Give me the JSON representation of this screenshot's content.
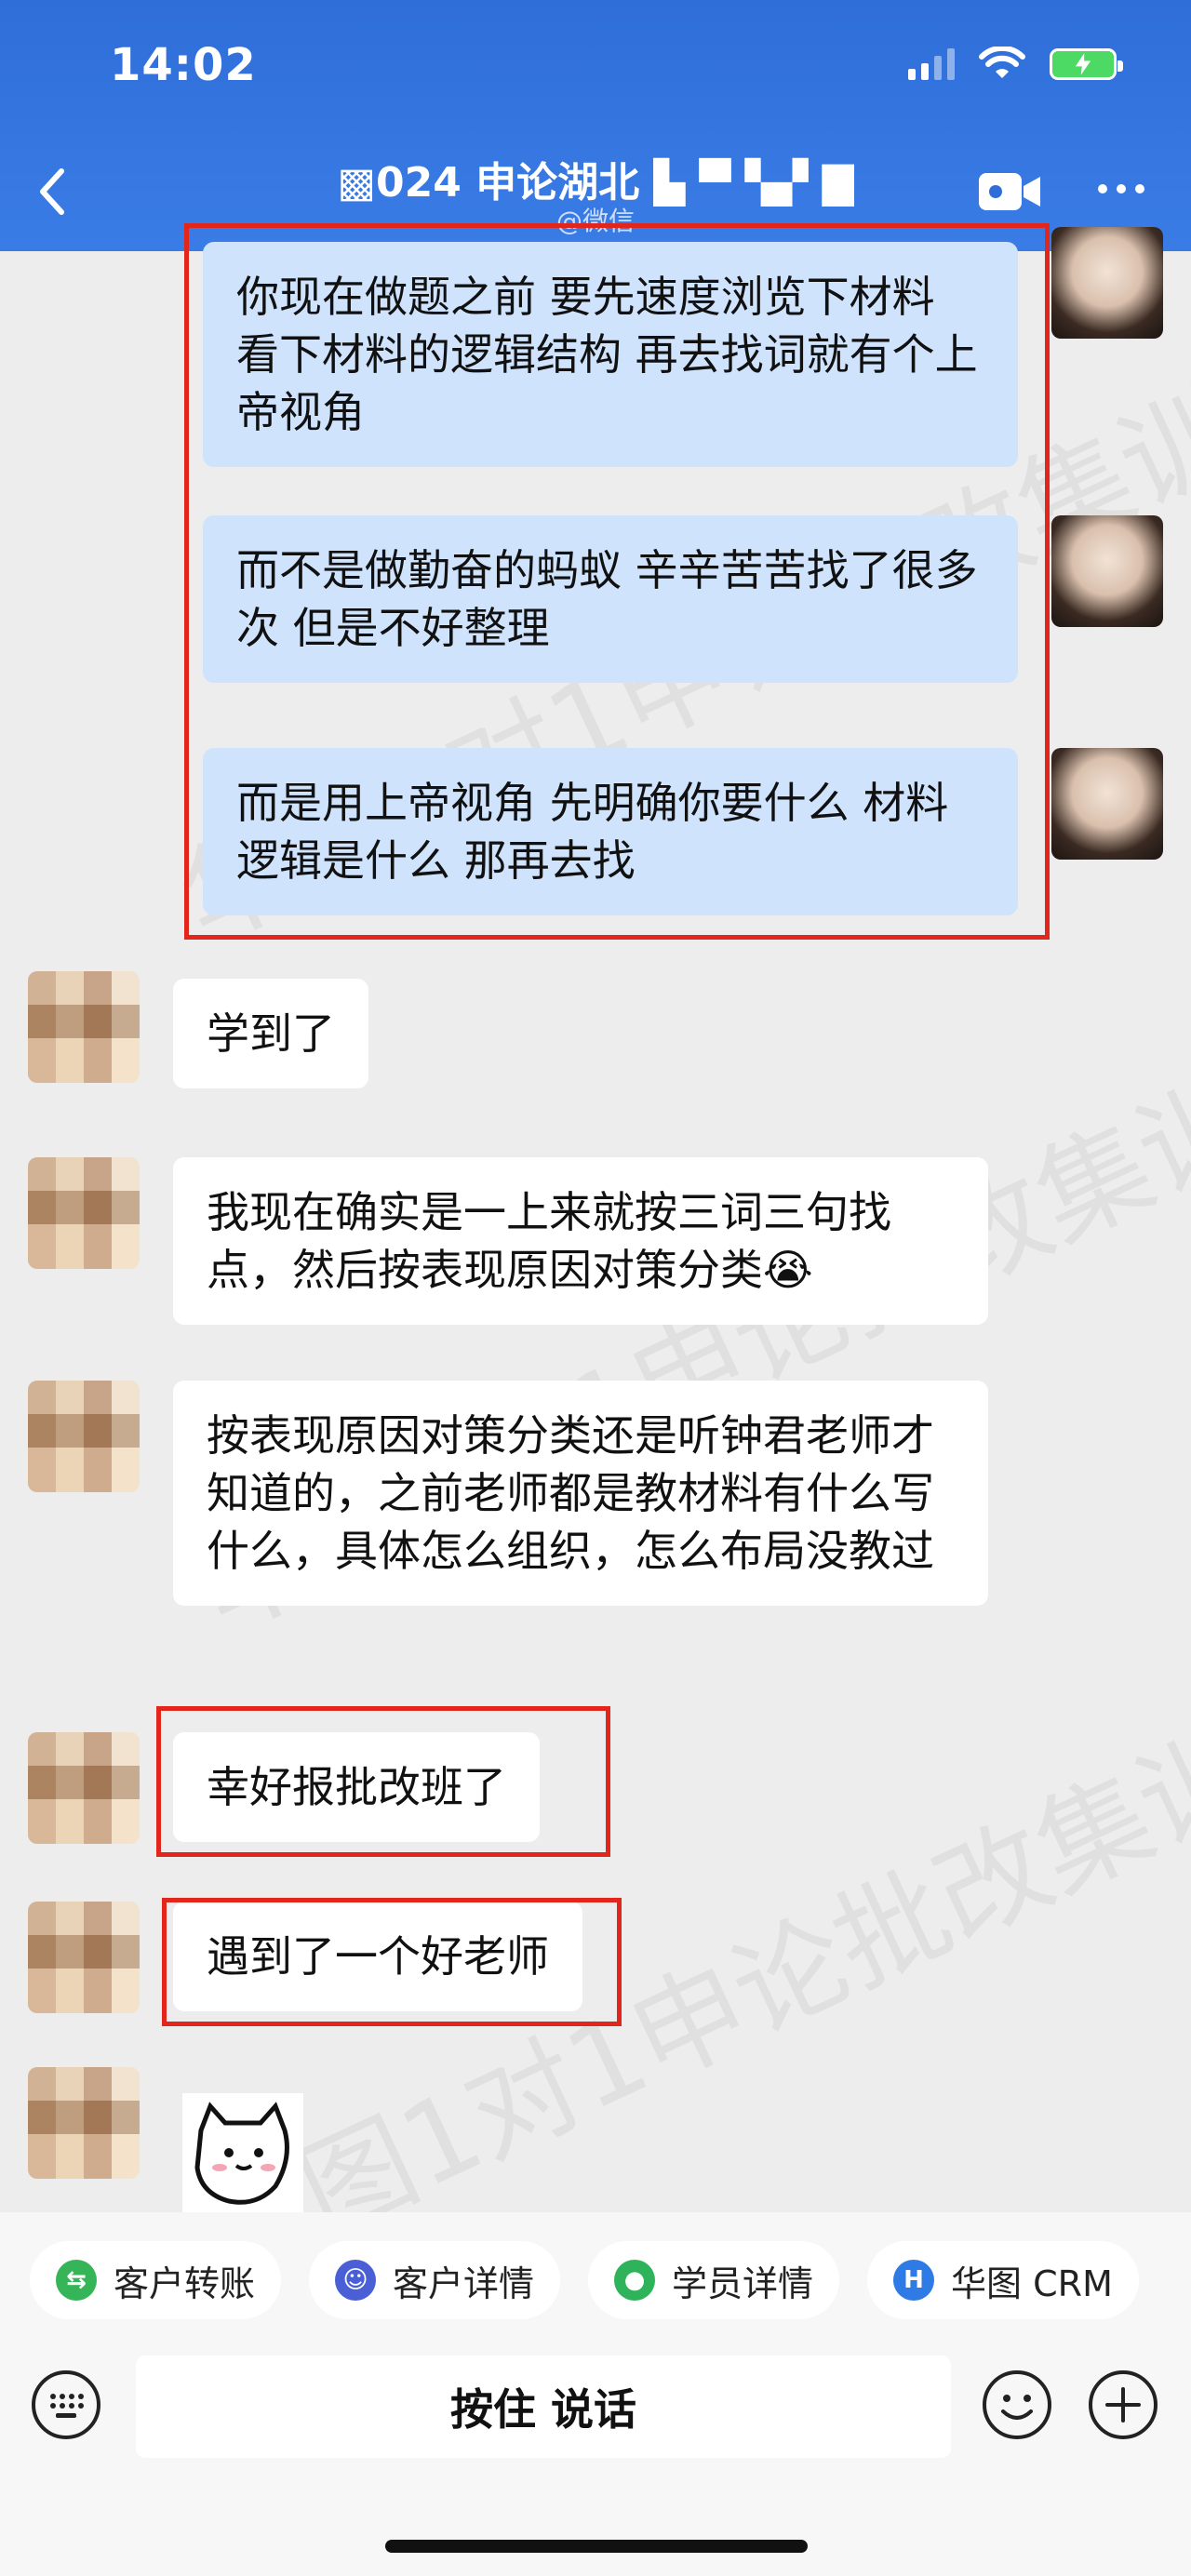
{
  "status_bar": {
    "time": "14:02"
  },
  "nav": {
    "title": "▩024 申论湖北 ▙ ▀ ▚▞ ▇",
    "subtitle": "@微信"
  },
  "messages": [
    {
      "side": "out",
      "text": "你现在做题之前 要先速度浏览下材料 看下材料的逻辑结构 再去找词就有个上帝视角"
    },
    {
      "side": "out",
      "text": "而不是做勤奋的蚂蚁 辛辛苦苦找了很多次 但是不好整理"
    },
    {
      "side": "out",
      "text": "而是用上帝视角 先明确你要什么 材料逻辑是什么 那再去找"
    },
    {
      "side": "in",
      "text": "学到了"
    },
    {
      "side": "in",
      "text": "我现在确实是一上来就按三词三句找点，然后按表现原因对策分类😭"
    },
    {
      "side": "in",
      "text": "按表现原因对策分类还是听钟君老师才知道的，之前老师都是教材料有什么写什么，具体怎么组织，怎么布局没教过"
    },
    {
      "side": "in",
      "text": "幸好报批改班了"
    },
    {
      "side": "in",
      "text": "遇到了一个好老师"
    }
  ],
  "watermark": "华图1对1申论批改集训",
  "shortcuts": [
    {
      "label": "客户转账",
      "icon": "transfer-icon",
      "color": "#35b558"
    },
    {
      "label": "客户详情",
      "icon": "customer-detail-icon",
      "color": "#4a5fd6"
    },
    {
      "label": "学员详情",
      "icon": "student-icon",
      "color": "#2fb35a"
    },
    {
      "label": "华图 CRM",
      "icon": "crm-icon",
      "color": "#2f7be6"
    }
  ],
  "input": {
    "voice_label": "按住 说话"
  },
  "colors": {
    "header": "#2f6ed8",
    "out_bubble": "#cfe3fd",
    "highlight": "#e2261c"
  }
}
